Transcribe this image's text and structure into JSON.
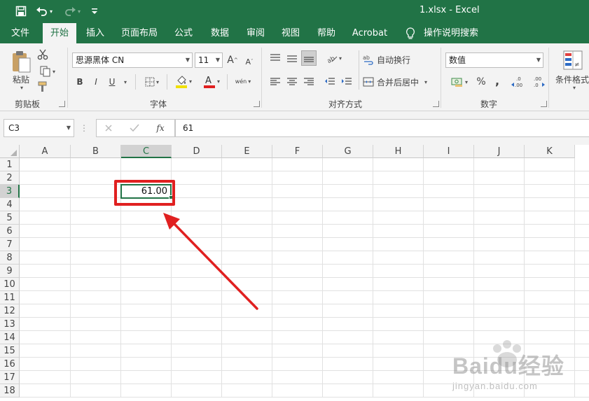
{
  "window": {
    "title": "1.xlsx  -  Excel"
  },
  "tabs": [
    {
      "label": "文件",
      "active": false
    },
    {
      "label": "开始",
      "active": true
    },
    {
      "label": "插入",
      "active": false
    },
    {
      "label": "页面布局",
      "active": false
    },
    {
      "label": "公式",
      "active": false
    },
    {
      "label": "数据",
      "active": false
    },
    {
      "label": "审阅",
      "active": false
    },
    {
      "label": "视图",
      "active": false
    },
    {
      "label": "帮助",
      "active": false
    },
    {
      "label": "Acrobat",
      "active": false
    }
  ],
  "tell_me": "操作说明搜索",
  "ribbon": {
    "clipboard": {
      "paste_label": "粘贴",
      "group_label": "剪贴板"
    },
    "font": {
      "font_name": "思源黑体 CN",
      "font_size": "11",
      "group_label": "字体",
      "bold": "B",
      "italic": "I",
      "underline": "U",
      "phonetic": "wén"
    },
    "alignment": {
      "wrap_text": "自动换行",
      "merge_center": "合并后居中",
      "group_label": "对齐方式"
    },
    "number": {
      "format": "数值",
      "percent": "%",
      "comma": ",",
      "group_label": "数字",
      "inc_decimal": "←.0 .00",
      "dec_decimal": ".00 →.0"
    },
    "styles": {
      "conditional_format": "条件格式"
    }
  },
  "formula_bar": {
    "name_box": "C3",
    "fx": "fx",
    "value": "61"
  },
  "sheet": {
    "columns": [
      "A",
      "B",
      "C",
      "D",
      "E",
      "F",
      "G",
      "H",
      "I",
      "J",
      "K"
    ],
    "selected_column": "C",
    "rows": [
      "1",
      "2",
      "3",
      "4",
      "5",
      "6",
      "7",
      "8",
      "9",
      "10",
      "11",
      "12",
      "13",
      "14",
      "15",
      "16",
      "17",
      "18"
    ],
    "selected_row": "3",
    "cells": {
      "C3": "61.00"
    }
  },
  "annotation": {
    "highlight_color": "#e02020"
  },
  "watermark": {
    "brand": "Baidu经验",
    "url": "jingyan.baidu.com"
  },
  "colors": {
    "excel_green": "#217346",
    "ribbon_bg": "#f3f3f3"
  }
}
